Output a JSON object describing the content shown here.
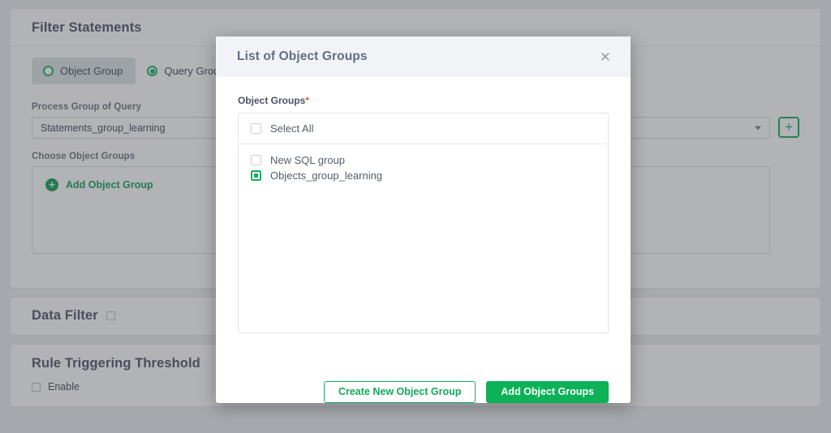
{
  "background": {
    "filter_statements": {
      "title": "Filter Statements",
      "radio_options": [
        {
          "label": "Object Group",
          "selected": false,
          "active_tab": true
        },
        {
          "label": "Query Group",
          "selected": true,
          "active_tab": false
        }
      ],
      "process_group_label": "Process Group of Query",
      "process_group_value": "Statements_group_learning",
      "add_group_button": "+",
      "choose_object_groups_label": "Choose Object Groups",
      "add_object_group_link": "Add Object Group",
      "add_icon": "plus-circle-icon"
    },
    "data_filter": {
      "title": "Data Filter",
      "checkbox_checked": false
    },
    "rule_triggering_threshold": {
      "title": "Rule Triggering Threshold",
      "enable_label": "Enable",
      "enable_checked": false
    }
  },
  "modal": {
    "title": "List of Object Groups",
    "close_icon": "close-icon",
    "field_label": "Object Groups",
    "required_marker": "*",
    "select_all_label": "Select All",
    "select_all_checked": false,
    "items": [
      {
        "label": "New SQL group",
        "selected": false
      },
      {
        "label": "Objects_group_learning",
        "selected": true
      }
    ],
    "buttons": {
      "create_new": "Create New Object Group",
      "add_groups": "Add Object Groups"
    }
  },
  "colors": {
    "accent_green": "#0bb257",
    "green_border": "#13b05c",
    "title_gray": "#4a5162",
    "modal_title_gray": "#646d84",
    "required_red": "#e0564e",
    "overlay": "rgba(70,74,80,0.42)"
  }
}
